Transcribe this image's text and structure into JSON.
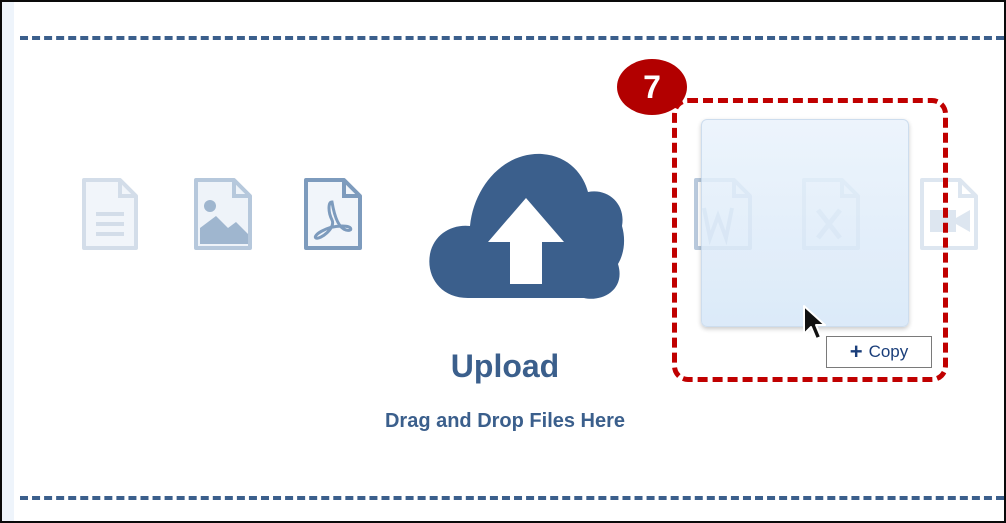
{
  "upload": {
    "title": "Upload",
    "subtitle": "Drag and Drop Files Here"
  },
  "annotation": {
    "step_number": "7",
    "tooltip_label": "Copy",
    "tooltip_symbol": "+"
  },
  "file_icons": [
    "document-icon",
    "image-icon",
    "pdf-icon",
    "word-icon",
    "excel-icon",
    "video-icon"
  ],
  "colors": {
    "primary": "#3b5f8c",
    "annotation_red": "#c00000",
    "badge_red": "#b20000",
    "icon_faded": "#b8c9dc"
  }
}
